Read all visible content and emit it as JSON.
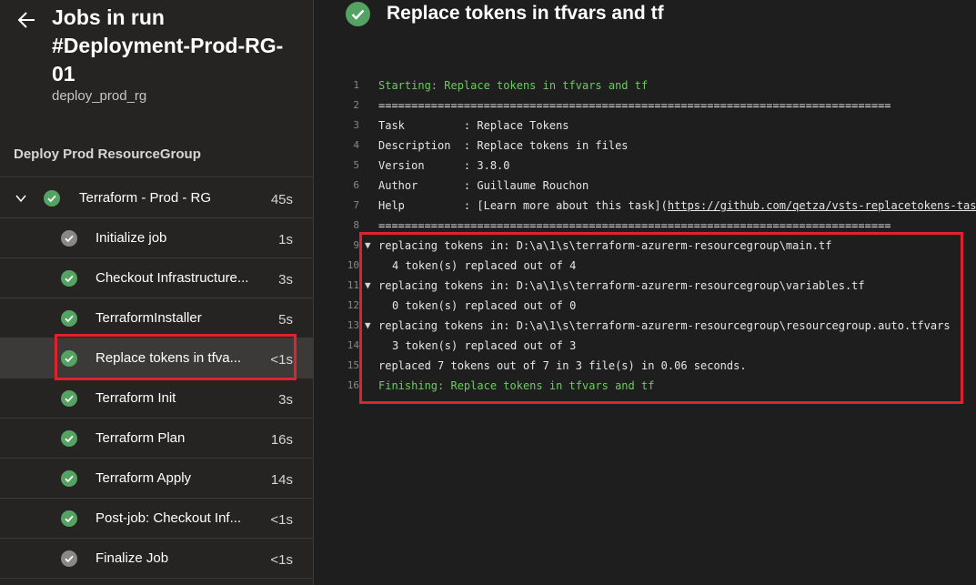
{
  "header": {
    "title": "Jobs in run #Deployment-Prod-RG-01",
    "subtitle": "deploy_prod_rg"
  },
  "stage": {
    "title": "Deploy Prod ResourceGroup"
  },
  "job": {
    "name": "Terraform - Prod - RG",
    "duration": "45s",
    "status": "succeeded"
  },
  "steps": [
    {
      "label": "Initialize job",
      "duration": "1s",
      "status": "succeeded-gray"
    },
    {
      "label": "Checkout Infrastructure...",
      "duration": "3s",
      "status": "succeeded"
    },
    {
      "label": "TerraformInstaller",
      "duration": "5s",
      "status": "succeeded"
    },
    {
      "label": "Replace tokens in tfva...",
      "duration": "<1s",
      "status": "succeeded",
      "selected": true
    },
    {
      "label": "Terraform Init",
      "duration": "3s",
      "status": "succeeded"
    },
    {
      "label": "Terraform Plan",
      "duration": "16s",
      "status": "succeeded"
    },
    {
      "label": "Terraform Apply",
      "duration": "14s",
      "status": "succeeded"
    },
    {
      "label": "Post-job: Checkout Inf...",
      "duration": "<1s",
      "status": "succeeded"
    },
    {
      "label": "Finalize Job",
      "duration": "<1s",
      "status": "succeeded-gray"
    }
  ],
  "main": {
    "title": "Replace tokens in tfvars and tf"
  },
  "log": [
    {
      "n": "1",
      "text": "Starting: Replace tokens in tfvars and tf"
    },
    {
      "n": "2",
      "text": "=============================================================================="
    },
    {
      "n": "3",
      "text": "Task         : Replace Tokens"
    },
    {
      "n": "4",
      "text": "Description  : Replace tokens in files"
    },
    {
      "n": "5",
      "text": "Version      : 3.8.0"
    },
    {
      "n": "6",
      "text": "Author       : Guillaume Rouchon"
    },
    {
      "n": "7",
      "text": "Help         : [Learn more about this task](",
      "link": "https://github.com/qetza/vsts-replacetokens-task"
    },
    {
      "n": "8",
      "text": "=============================================================================="
    },
    {
      "n": "9",
      "text": "replacing tokens in: D:\\a\\1\\s\\terraform-azurerm-resourcegroup\\main.tf"
    },
    {
      "n": "10",
      "text": "4 token(s) replaced out of 4"
    },
    {
      "n": "11",
      "text": "replacing tokens in: D:\\a\\1\\s\\terraform-azurerm-resourcegroup\\variables.tf"
    },
    {
      "n": "12",
      "text": "0 token(s) replaced out of 0"
    },
    {
      "n": "13",
      "text": "replacing tokens in: D:\\a\\1\\s\\terraform-azurerm-resourcegroup\\resourcegroup.auto.tfvars"
    },
    {
      "n": "14",
      "text": "3 token(s) replaced out of 3"
    },
    {
      "n": "15",
      "text": "replaced 7 tokens out of 7 in 3 file(s) in 0.06 seconds."
    },
    {
      "n": "16",
      "text": "Finishing: Replace tokens in tfvars and tf"
    }
  ],
  "colors": {
    "success": "#55a362",
    "success_gray": "#8a8886",
    "highlight": "#e0212e",
    "log_green": "#6ccb5f"
  },
  "icons": {
    "back": "arrow-left-icon",
    "expand": "chevron-down-icon",
    "status": "check-circle-icon"
  }
}
